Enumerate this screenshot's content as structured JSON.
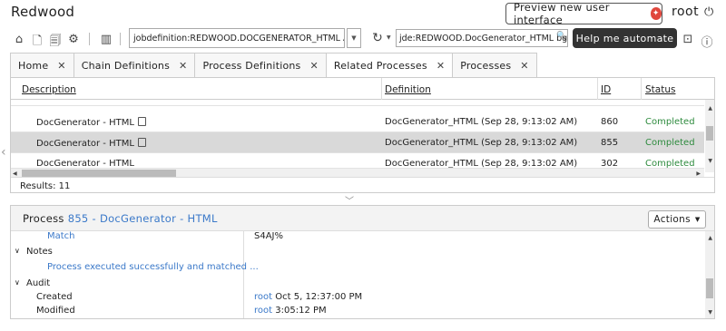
{
  "header": {
    "brand": "Redwood",
    "preview_label": "Preview new user interface",
    "user": "root"
  },
  "toolbar": {
    "combo_value": "jobdefinition:REDWOOD.DOCGENERATOR_HTML AND ...",
    "search_value": "jde:REDWOOD.DocGenerator_HTML bg:",
    "automate_label": "Help me automate"
  },
  "tabs": [
    {
      "label": "Home"
    },
    {
      "label": "Chain Definitions"
    },
    {
      "label": "Process Definitions"
    },
    {
      "label": "Related Processes"
    },
    {
      "label": "Processes"
    }
  ],
  "grid": {
    "columns": [
      "Description",
      "Definition",
      "ID",
      "Status"
    ],
    "rows": [
      {
        "description": "DocGenerator - HTML",
        "definition": "DocGenerator_HTML (Sep 28, 9:13:02 AM)",
        "id": "860",
        "status": "Completed",
        "note": true
      },
      {
        "description": "DocGenerator - HTML",
        "definition": "DocGenerator_HTML (Sep 28, 9:13:02 AM)",
        "id": "855",
        "status": "Completed",
        "note": true
      },
      {
        "description": "DocGenerator - HTML",
        "definition": "DocGenerator_HTML (Sep 28, 9:13:02 AM)",
        "id": "302",
        "status": "Completed",
        "note": false
      }
    ],
    "results": "Results: 11"
  },
  "detail": {
    "title_prefix": "Process",
    "title_id": "855",
    "title_sep": " - ",
    "title_name": "DocGenerator - HTML",
    "actions_label": "Actions",
    "match_label": "Match",
    "match_value": "S4AJ%",
    "notes_label": "Notes",
    "note_text": "Process executed successfully and matched ...",
    "audit_label": "Audit",
    "created_label": "Created",
    "created_by": "root",
    "created_value": "Oct 5, 12:37:00 PM",
    "modified_label": "Modified",
    "modified_by": "root",
    "modified_value": "3:05:12 PM"
  },
  "colors": {
    "link": "#3b79c9",
    "completed": "#2e8b3e",
    "dark_button": "#333333",
    "preview_dot": "#e0473d"
  }
}
